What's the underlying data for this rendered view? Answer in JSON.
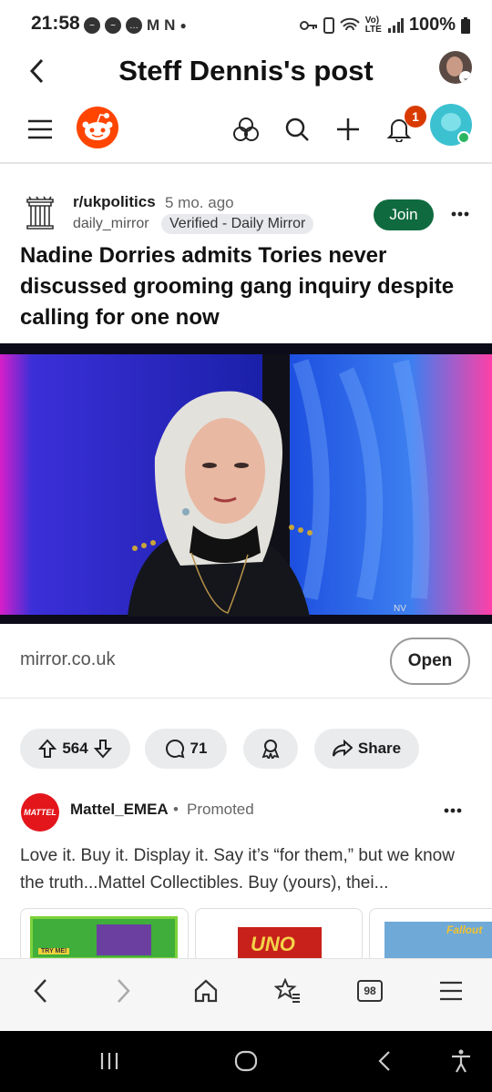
{
  "status_bar": {
    "time": "21:58",
    "notification_icons": [
      "messenger-icon",
      "messenger-icon",
      "chat-icon",
      "gmail-icon",
      "netflix-icon",
      "dot-icon"
    ],
    "gmail_letter": "M",
    "netflix_letter": "N",
    "battery": "100%"
  },
  "title_bar": {
    "title": "Steff Dennis's post"
  },
  "reddit_nav": {
    "notification_count": "1"
  },
  "post": {
    "subreddit": "r/ukpolitics",
    "age": "5 mo. ago",
    "author": "daily_mirror",
    "verified_label": "Verified - Daily Mirror",
    "join_label": "Join",
    "headline": "Nadine Dorries admits Tories never discussed grooming gang inquiry despite calling for one now",
    "image_watermark": "NV",
    "link_domain": "mirror.co.uk",
    "open_label": "Open",
    "upvotes": "564",
    "comments": "71",
    "share_label": "Share"
  },
  "promoted": {
    "avatar_text": "MATTEL",
    "name": "Mattel_EMEA",
    "separator": "•",
    "label": "Promoted",
    "text": "Love it. Buy it. Display it. Say it’s “for them,” but we know the truth...Mattel Collectibles. Buy (yours), thei...",
    "thumbs": [
      {
        "label": "TRY ME!"
      },
      {
        "label": "UNO"
      },
      {
        "label": "Fallout"
      }
    ]
  },
  "browser_bar": {
    "tab_count": "98"
  },
  "colors": {
    "reddit_orange": "#ff4500",
    "join_green": "#0f6b3f",
    "badge_red": "#d93a00",
    "avatar_teal": "#3cc1d1"
  }
}
